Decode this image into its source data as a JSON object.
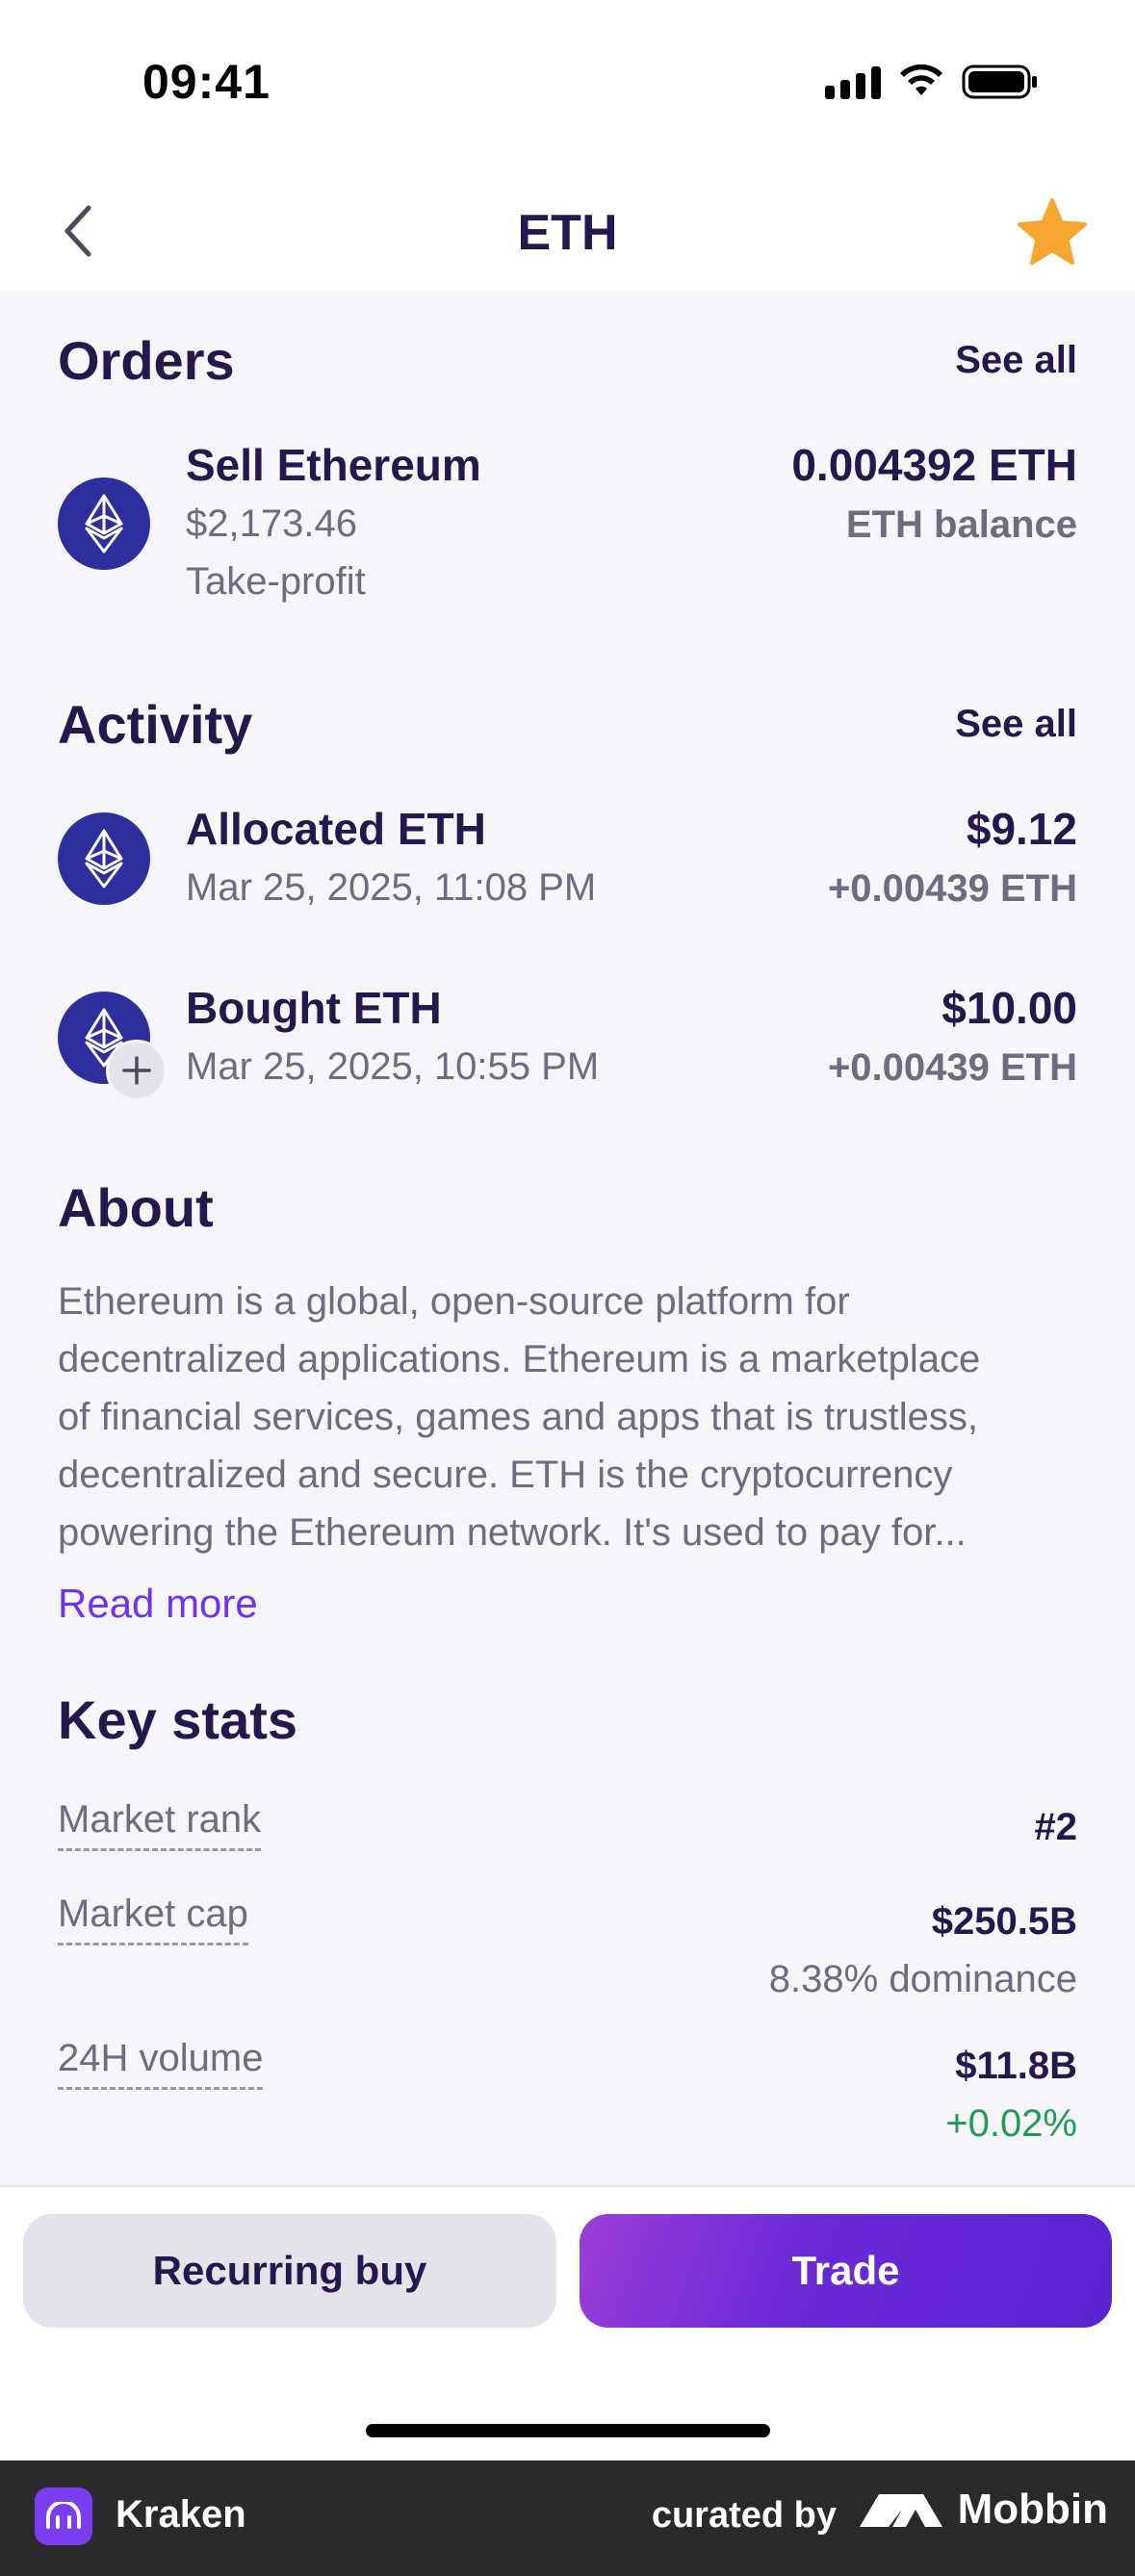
{
  "status_bar": {
    "time": "09:41"
  },
  "nav": {
    "title": "ETH"
  },
  "orders": {
    "title": "Orders",
    "see_all": "See all",
    "item": {
      "title": "Sell Ethereum",
      "price": "$2,173.46",
      "type": "Take-profit",
      "amount": "0.004392 ETH",
      "amount_label": "ETH balance"
    }
  },
  "activity": {
    "title": "Activity",
    "see_all": "See all",
    "items": [
      {
        "title": "Allocated ETH",
        "date": "Mar 25, 2025, 11:08 PM",
        "value": "$9.12",
        "change": "+0.00439 ETH"
      },
      {
        "title": "Bought ETH",
        "date": "Mar 25, 2025, 10:55 PM",
        "value": "$10.00",
        "change": "+0.00439 ETH"
      }
    ]
  },
  "about": {
    "title": "About",
    "lines": [
      "Ethereum is a global, open-source platform for",
      "decentralized applications. Ethereum is a marketplace",
      "of financial services, games and apps that is trustless,",
      "decentralized and secure. ETH is the cryptocurrency",
      "powering the Ethereum network. It's used to pay for..."
    ],
    "read_more": "Read more"
  },
  "key_stats": {
    "title": "Key stats",
    "market_rank": {
      "label": "Market rank",
      "value": "#2"
    },
    "market_cap": {
      "label": "Market cap",
      "value": "$250.5B",
      "sub": "8.38% dominance"
    },
    "volume_24h": {
      "label": "24H volume",
      "value": "$11.8B",
      "sub": "+0.02%"
    }
  },
  "actions": {
    "recurring_buy": "Recurring buy",
    "trade": "Trade"
  },
  "watermark": {
    "app_name": "Kraken",
    "curated_by": "curated by",
    "brand": "Mobbin"
  },
  "colors": {
    "text_primary": "#25184d",
    "text_secondary": "#6f6b80",
    "accent": "#7132f5",
    "positive": "#1f9d55",
    "eth_avatar": "#2e2e9e",
    "star": "#f7a531"
  },
  "icons": {
    "back": "chevron-left-icon",
    "favorite": "star-icon",
    "coin": "ethereum-icon",
    "badge": "plus-icon"
  }
}
